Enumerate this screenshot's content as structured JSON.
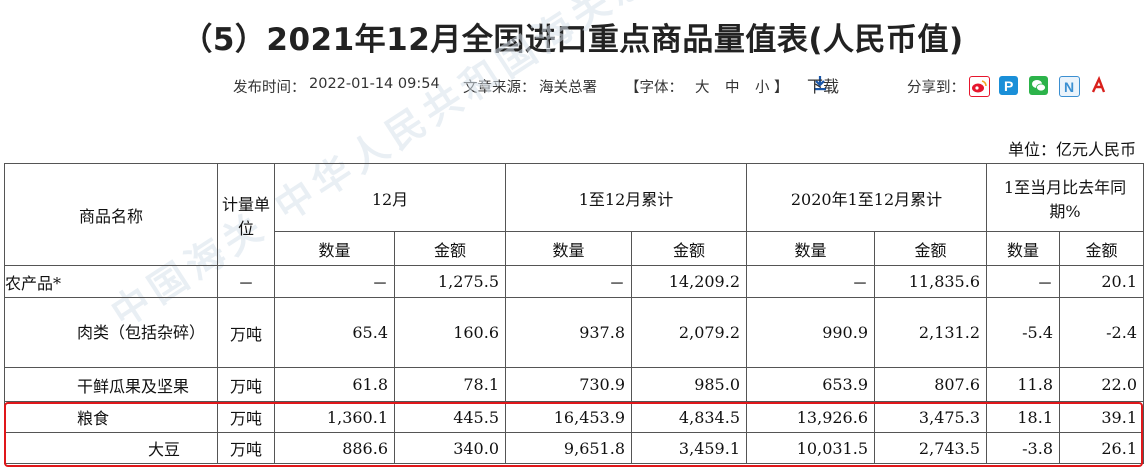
{
  "title": "（5）2021年12月全国进口重点商品量值表(人民币值)",
  "meta": {
    "publish_label": "发布时间：",
    "publish_time": "2022-01-14 09:54",
    "source_label": "文章来源：",
    "source": "海关总署",
    "font_label": "【字体：",
    "font_large": "大",
    "font_medium": "中",
    "font_small": "小",
    "font_close": "】",
    "download": "下载",
    "share_label": "分享到："
  },
  "share_icons": [
    {
      "name": "weibo",
      "color": "#e6162d",
      "glyph": "微"
    },
    {
      "name": "tencent-weibo",
      "color": "#1a8fd8",
      "glyph": "P"
    },
    {
      "name": "wechat",
      "color": "#2cb34a",
      "glyph": "●"
    },
    {
      "name": "renren",
      "color": "#3b8fd1",
      "glyph": "N"
    },
    {
      "name": "douban",
      "color": "#d9201c",
      "glyph": "人"
    }
  ],
  "unit_label": "单位：亿元人民币",
  "watermark": "中国海关 中华人民共和国海关总署",
  "headers": {
    "name": "商品名称",
    "unit": "计量单位",
    "dec": "12月",
    "ytd": "1至12月累计",
    "prev": "2020年1至12月累计",
    "yoy": "1至当月比去年同期%",
    "qty": "数量",
    "amt": "金额"
  },
  "rows": [
    {
      "name": "农产品*",
      "unit": "－",
      "dec_qty": "－",
      "dec_amt": "1,275.5",
      "ytd_qty": "－",
      "ytd_amt": "14,209.2",
      "prev_qty": "－",
      "prev_amt": "11,835.6",
      "yoy_qty": "－",
      "yoy_amt": "20.1"
    },
    {
      "name": "肉类（包括杂碎）",
      "unit": "万吨",
      "dec_qty": "65.4",
      "dec_amt": "160.6",
      "ytd_qty": "937.8",
      "ytd_amt": "2,079.2",
      "prev_qty": "990.9",
      "prev_amt": "2,131.2",
      "yoy_qty": "-5.4",
      "yoy_amt": "-2.4"
    },
    {
      "name": "干鲜瓜果及坚果",
      "unit": "万吨",
      "dec_qty": "61.8",
      "dec_amt": "78.1",
      "ytd_qty": "730.9",
      "ytd_amt": "985.0",
      "prev_qty": "653.9",
      "prev_amt": "807.6",
      "yoy_qty": "11.8",
      "yoy_amt": "22.0"
    },
    {
      "name": "粮食",
      "unit": "万吨",
      "dec_qty": "1,360.1",
      "dec_amt": "445.5",
      "ytd_qty": "16,453.9",
      "ytd_amt": "4,834.5",
      "prev_qty": "13,926.6",
      "prev_amt": "3,475.3",
      "yoy_qty": "18.1",
      "yoy_amt": "39.1"
    },
    {
      "name": "大豆",
      "unit": "万吨",
      "dec_qty": "886.6",
      "dec_amt": "340.0",
      "ytd_qty": "9,651.8",
      "ytd_amt": "3,459.1",
      "prev_qty": "10,031.5",
      "prev_amt": "2,743.5",
      "yoy_qty": "-3.8",
      "yoy_amt": "26.1"
    }
  ]
}
